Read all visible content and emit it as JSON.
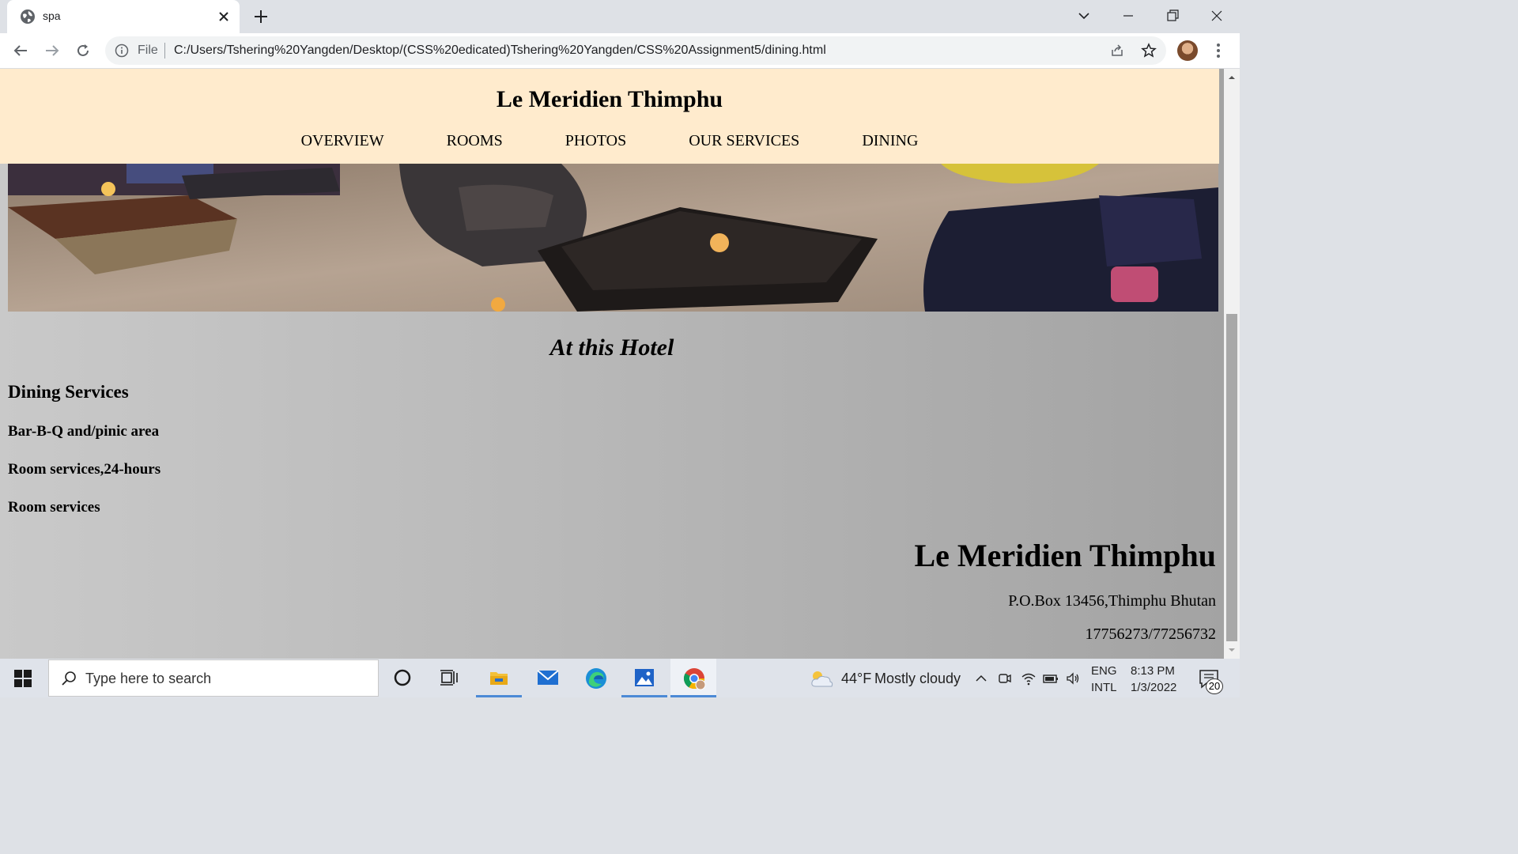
{
  "browser": {
    "tab_title": "spa",
    "url_scheme": "File",
    "url": "C:/Users/Tshering%20Yangden/Desktop/(CSS%20edicated)Tshering%20Yangden/CSS%20Assignment5/dining.html"
  },
  "page": {
    "site_title": "Le Meridien Thimphu",
    "nav": [
      "OVERVIEW",
      "ROOMS",
      "PHOTOS",
      "OUR SERVICES",
      "DINING"
    ],
    "section_title": "At this Hotel",
    "dining_heading": "Dining Services",
    "dining_items": [
      "Bar-B-Q and/pinic area",
      "Room services,24-hours",
      "Room services"
    ],
    "footer": {
      "name": "Le Meridien Thimphu",
      "address": "P.O.Box 13456,Thimphu Bhutan",
      "phone": "17756273/77256732"
    },
    "colors": {
      "header_bg": "#ffebcd",
      "content_bg": "#bdbdbd"
    }
  },
  "taskbar": {
    "search_placeholder": "Type here to search",
    "weather_temp": "44°F",
    "weather_condition": "Mostly cloudy",
    "lang_line1": "ENG",
    "lang_line2": "INTL",
    "time": "8:13 PM",
    "date": "1/3/2022",
    "notification_count": "20"
  }
}
